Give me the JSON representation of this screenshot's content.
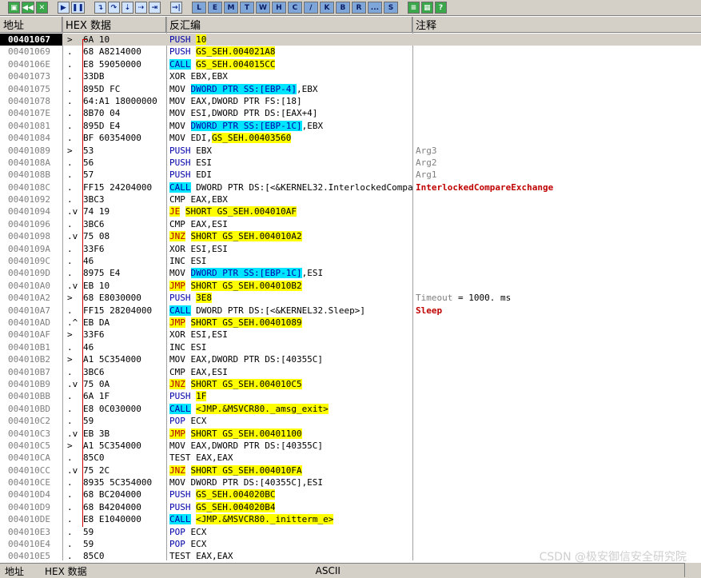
{
  "toolbar": {
    "buttons": [
      {
        "icon": "open-icon",
        "label": "▣"
      },
      {
        "icon": "restart-icon",
        "label": "◀◀"
      },
      {
        "icon": "close-icon",
        "label": "✕"
      },
      {
        "icon": "run-icon",
        "label": "▶"
      },
      {
        "icon": "pause-icon",
        "label": "❚❚"
      },
      {
        "icon": "step-into-icon",
        "label": "↴"
      },
      {
        "icon": "step-over-icon",
        "label": "↷"
      },
      {
        "icon": "trace-into-icon",
        "label": "⇣"
      },
      {
        "icon": "trace-over-icon",
        "label": "⇢"
      },
      {
        "icon": "execute-till-return-icon",
        "label": "⇥"
      },
      {
        "icon": "goto-icon",
        "label": "→|"
      }
    ],
    "letters": [
      "L",
      "E",
      "M",
      "T",
      "W",
      "H",
      "C",
      "/",
      "K",
      "B",
      "R",
      "...",
      "S"
    ],
    "extra": [
      {
        "icon": "list-icon",
        "label": "≡"
      },
      {
        "icon": "grid-icon",
        "label": "▦"
      },
      {
        "icon": "help-icon",
        "label": "?"
      }
    ]
  },
  "header": {
    "addr": "地址",
    "hex": "HEX 数据",
    "dis": "反汇编",
    "cmt": "注释"
  },
  "rows": [
    {
      "addr": "00401067",
      "mark": "> ",
      "hex": "6A 10",
      "dis": [
        [
          "push",
          "PUSH"
        ],
        [
          "plain",
          " "
        ],
        [
          "arg",
          "10"
        ]
      ],
      "cmt": []
    },
    {
      "addr": "00401069",
      "mark": ". ",
      "hex": "68 A8214000",
      "dis": [
        [
          "push",
          "PUSH"
        ],
        [
          "plain",
          " "
        ],
        [
          "arg",
          "GS_SEH.004021A8"
        ]
      ],
      "cmt": []
    },
    {
      "addr": "0040106E",
      "mark": ". ",
      "hex": "E8 59050000",
      "dis": [
        [
          "call",
          "CALL"
        ],
        [
          "plain",
          " "
        ],
        [
          "arg",
          "GS_SEH.004015CC"
        ]
      ],
      "cmt": []
    },
    {
      "addr": "00401073",
      "mark": ". ",
      "hex": "33DB",
      "dis": [
        [
          "plain",
          "XOR EBX,EBX"
        ]
      ],
      "cmt": []
    },
    {
      "addr": "00401075",
      "mark": ". ",
      "hex": "895D FC",
      "dis": [
        [
          "plain",
          "MOV "
        ],
        [
          "mem",
          "DWORD PTR SS:[EBP-4]"
        ],
        [
          "plain",
          ",EBX"
        ]
      ],
      "cmt": []
    },
    {
      "addr": "00401078",
      "mark": ". ",
      "hex": "64:A1 18000000",
      "dis": [
        [
          "plain",
          "MOV EAX,DWORD PTR FS:[18]"
        ]
      ],
      "cmt": []
    },
    {
      "addr": "0040107E",
      "mark": ". ",
      "hex": "8B70 04",
      "dis": [
        [
          "plain",
          "MOV ESI,DWORD PTR DS:[EAX+4]"
        ]
      ],
      "cmt": []
    },
    {
      "addr": "00401081",
      "mark": ". ",
      "hex": "895D E4",
      "dis": [
        [
          "plain",
          "MOV "
        ],
        [
          "mem",
          "DWORD PTR SS:[EBP-1C]"
        ],
        [
          "plain",
          ",EBX"
        ]
      ],
      "cmt": []
    },
    {
      "addr": "00401084",
      "mark": ". ",
      "hex": "BF 60354000",
      "dis": [
        [
          "plain",
          "MOV EDI,"
        ],
        [
          "arg",
          "GS_SEH.00403560"
        ]
      ],
      "cmt": []
    },
    {
      "addr": "00401089",
      "mark": "> ",
      "hex": "53",
      "dis": [
        [
          "push",
          "PUSH"
        ],
        [
          "plain",
          " EBX"
        ]
      ],
      "cmt": [
        [
          "gray",
          "Arg3"
        ]
      ]
    },
    {
      "addr": "0040108A",
      "mark": ". ",
      "hex": "56",
      "dis": [
        [
          "push",
          "PUSH"
        ],
        [
          "plain",
          " ESI"
        ]
      ],
      "cmt": [
        [
          "gray",
          "Arg2"
        ]
      ]
    },
    {
      "addr": "0040108B",
      "mark": ". ",
      "hex": "57",
      "dis": [
        [
          "push",
          "PUSH"
        ],
        [
          "plain",
          " EDI"
        ]
      ],
      "cmt": [
        [
          "gray",
          "Arg1"
        ]
      ]
    },
    {
      "addr": "0040108C",
      "mark": ". ",
      "hex": "FF15 24204000",
      "dis": [
        [
          "call",
          "CALL"
        ],
        [
          "plain",
          " DWORD PTR DS:[<&KERNEL32.InterlockedCompareExchange>]"
        ]
      ],
      "cmt": [
        [
          "red",
          "InterlockedCompareExchange"
        ]
      ]
    },
    {
      "addr": "00401092",
      "mark": ". ",
      "hex": "3BC3",
      "dis": [
        [
          "plain",
          "CMP EAX,EBX"
        ]
      ],
      "cmt": []
    },
    {
      "addr": "00401094",
      "mark": ".v",
      "hex": "74 19",
      "dis": [
        [
          "jmp",
          "JE"
        ],
        [
          "plain",
          " "
        ],
        [
          "arg",
          "SHORT GS_SEH.004010AF"
        ]
      ],
      "cmt": []
    },
    {
      "addr": "00401096",
      "mark": ". ",
      "hex": "3BC6",
      "dis": [
        [
          "plain",
          "CMP EAX,ESI"
        ]
      ],
      "cmt": []
    },
    {
      "addr": "00401098",
      "mark": ".v",
      "hex": "75 08",
      "dis": [
        [
          "jmp",
          "JNZ"
        ],
        [
          "plain",
          " "
        ],
        [
          "arg",
          "SHORT GS_SEH.004010A2"
        ]
      ],
      "cmt": []
    },
    {
      "addr": "0040109A",
      "mark": ". ",
      "hex": "33F6",
      "dis": [
        [
          "plain",
          "XOR ESI,ESI"
        ]
      ],
      "cmt": []
    },
    {
      "addr": "0040109C",
      "mark": ". ",
      "hex": "46",
      "dis": [
        [
          "plain",
          "INC ESI"
        ]
      ],
      "cmt": []
    },
    {
      "addr": "0040109D",
      "mark": ". ",
      "hex": "8975 E4",
      "dis": [
        [
          "plain",
          "MOV "
        ],
        [
          "mem",
          "DWORD PTR SS:[EBP-1C]"
        ],
        [
          "plain",
          ",ESI"
        ]
      ],
      "cmt": []
    },
    {
      "addr": "004010A0",
      "mark": ".v",
      "hex": "EB 10",
      "dis": [
        [
          "jmp",
          "JMP"
        ],
        [
          "plain",
          " "
        ],
        [
          "arg",
          "SHORT GS_SEH.004010B2"
        ]
      ],
      "cmt": []
    },
    {
      "addr": "004010A2",
      "mark": "> ",
      "hex": "68 E8030000",
      "dis": [
        [
          "push",
          "PUSH"
        ],
        [
          "plain",
          " "
        ],
        [
          "arg",
          "3E8"
        ]
      ],
      "cmt": [
        [
          "gray",
          "Timeout"
        ],
        [
          "black",
          " = 1000. ms"
        ]
      ]
    },
    {
      "addr": "004010A7",
      "mark": ". ",
      "hex": "FF15 28204000",
      "dis": [
        [
          "call",
          "CALL"
        ],
        [
          "plain",
          " DWORD PTR DS:[<&KERNEL32.Sleep>]"
        ]
      ],
      "cmt": [
        [
          "red",
          "Sleep"
        ]
      ]
    },
    {
      "addr": "004010AD",
      "mark": ".^",
      "hex": "EB DA",
      "dis": [
        [
          "jmp",
          "JMP"
        ],
        [
          "plain",
          " "
        ],
        [
          "arg",
          "SHORT GS_SEH.00401089"
        ]
      ],
      "cmt": []
    },
    {
      "addr": "004010AF",
      "mark": "> ",
      "hex": "33F6",
      "dis": [
        [
          "plain",
          "XOR ESI,ESI"
        ]
      ],
      "cmt": []
    },
    {
      "addr": "004010B1",
      "mark": ". ",
      "hex": "46",
      "dis": [
        [
          "plain",
          "INC ESI"
        ]
      ],
      "cmt": []
    },
    {
      "addr": "004010B2",
      "mark": "> ",
      "hex": "A1 5C354000",
      "dis": [
        [
          "plain",
          "MOV EAX,DWORD PTR DS:[40355C]"
        ]
      ],
      "cmt": []
    },
    {
      "addr": "004010B7",
      "mark": ". ",
      "hex": "3BC6",
      "dis": [
        [
          "plain",
          "CMP EAX,ESI"
        ]
      ],
      "cmt": []
    },
    {
      "addr": "004010B9",
      "mark": ".v",
      "hex": "75 0A",
      "dis": [
        [
          "jmp",
          "JNZ"
        ],
        [
          "plain",
          " "
        ],
        [
          "arg",
          "SHORT GS_SEH.004010C5"
        ]
      ],
      "cmt": []
    },
    {
      "addr": "004010BB",
      "mark": ". ",
      "hex": "6A 1F",
      "dis": [
        [
          "push",
          "PUSH"
        ],
        [
          "plain",
          " "
        ],
        [
          "arg",
          "1F"
        ]
      ],
      "cmt": []
    },
    {
      "addr": "004010BD",
      "mark": ". ",
      "hex": "E8 0C030000",
      "dis": [
        [
          "call",
          "CALL"
        ],
        [
          "plain",
          " "
        ],
        [
          "arg",
          "<JMP.&MSVCR80._amsg_exit>"
        ]
      ],
      "cmt": []
    },
    {
      "addr": "004010C2",
      "mark": ". ",
      "hex": "59",
      "dis": [
        [
          "push",
          "POP"
        ],
        [
          "plain",
          " ECX"
        ]
      ],
      "cmt": []
    },
    {
      "addr": "004010C3",
      "mark": ".v",
      "hex": "EB 3B",
      "dis": [
        [
          "jmp",
          "JMP"
        ],
        [
          "plain",
          " "
        ],
        [
          "arg",
          "SHORT GS_SEH.00401100"
        ]
      ],
      "cmt": []
    },
    {
      "addr": "004010C5",
      "mark": "> ",
      "hex": "A1 5C354000",
      "dis": [
        [
          "plain",
          "MOV EAX,DWORD PTR DS:[40355C]"
        ]
      ],
      "cmt": []
    },
    {
      "addr": "004010CA",
      "mark": ". ",
      "hex": "85C0",
      "dis": [
        [
          "plain",
          "TEST EAX,EAX"
        ]
      ],
      "cmt": []
    },
    {
      "addr": "004010CC",
      "mark": ".v",
      "hex": "75 2C",
      "dis": [
        [
          "jmp",
          "JNZ"
        ],
        [
          "plain",
          " "
        ],
        [
          "arg",
          "SHORT GS_SEH.004010FA"
        ]
      ],
      "cmt": []
    },
    {
      "addr": "004010CE",
      "mark": ". ",
      "hex": "8935 5C354000",
      "dis": [
        [
          "plain",
          "MOV DWORD PTR DS:[40355C],ESI"
        ]
      ],
      "cmt": []
    },
    {
      "addr": "004010D4",
      "mark": ". ",
      "hex": "68 BC204000",
      "dis": [
        [
          "push",
          "PUSH"
        ],
        [
          "plain",
          " "
        ],
        [
          "arg",
          "GS_SEH.004020BC"
        ]
      ],
      "cmt": []
    },
    {
      "addr": "004010D9",
      "mark": ". ",
      "hex": "68 B4204000",
      "dis": [
        [
          "push",
          "PUSH"
        ],
        [
          "plain",
          " "
        ],
        [
          "arg",
          "GS_SEH.004020B4"
        ]
      ],
      "cmt": []
    },
    {
      "addr": "004010DE",
      "mark": ". ",
      "hex": "E8 E1040000",
      "dis": [
        [
          "call",
          "CALL"
        ],
        [
          "plain",
          " "
        ],
        [
          "arg",
          "<JMP.&MSVCR80._initterm_e>"
        ]
      ],
      "cmt": []
    },
    {
      "addr": "004010E3",
      "mark": ". ",
      "hex": "59",
      "dis": [
        [
          "push",
          "POP"
        ],
        [
          "plain",
          " ECX"
        ]
      ],
      "cmt": []
    },
    {
      "addr": "004010E4",
      "mark": ". ",
      "hex": "59",
      "dis": [
        [
          "push",
          "POP"
        ],
        [
          "plain",
          " ECX"
        ]
      ],
      "cmt": []
    },
    {
      "addr": "004010E5",
      "mark": ". ",
      "hex": "85C0",
      "dis": [
        [
          "plain",
          "TEST EAX,EAX"
        ]
      ],
      "cmt": []
    }
  ],
  "bottom": {
    "addr": "地址",
    "hex": "HEX 数据",
    "ascii": "ASCII"
  },
  "watermark": "CSDN @极安御信安全研究院"
}
